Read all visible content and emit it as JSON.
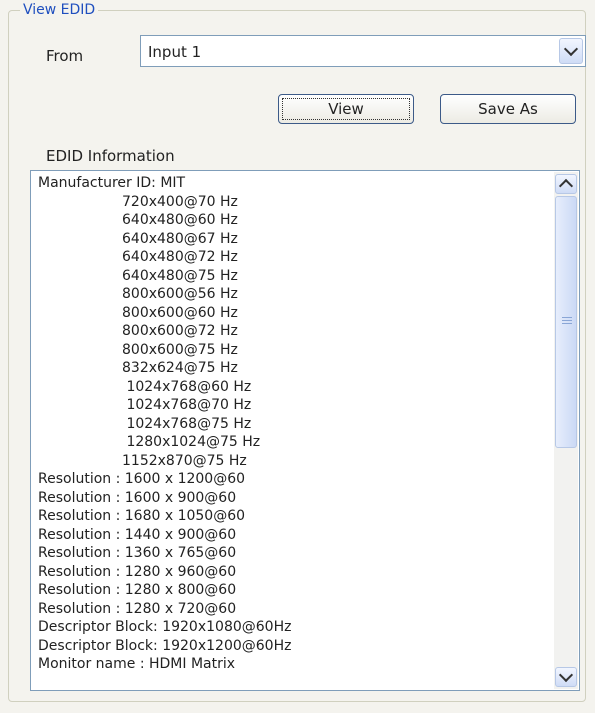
{
  "group": {
    "title": "View EDID"
  },
  "from": {
    "label": "From",
    "selected": "Input 1"
  },
  "buttons": {
    "view": "View",
    "save_as": "Save As"
  },
  "edid": {
    "label": "EDID Information",
    "lines": [
      {
        "text": "Manufacturer ID: MIT",
        "indent": false
      },
      {
        "text": "720x400@70 Hz",
        "indent": true
      },
      {
        "text": "640x480@60 Hz",
        "indent": true
      },
      {
        "text": "640x480@67 Hz",
        "indent": true
      },
      {
        "text": "640x480@72 Hz",
        "indent": true
      },
      {
        "text": "640x480@75 Hz",
        "indent": true
      },
      {
        "text": "800x600@56 Hz",
        "indent": true
      },
      {
        "text": "800x600@60 Hz",
        "indent": true
      },
      {
        "text": "800x600@72 Hz",
        "indent": true
      },
      {
        "text": "800x600@75 Hz",
        "indent": true
      },
      {
        "text": "832x624@75 Hz",
        "indent": true
      },
      {
        "text": " 1024x768@60 Hz",
        "indent": true
      },
      {
        "text": " 1024x768@70 Hz",
        "indent": true
      },
      {
        "text": " 1024x768@75 Hz",
        "indent": true
      },
      {
        "text": " 1280x1024@75 Hz",
        "indent": true
      },
      {
        "text": "1152x870@75 Hz",
        "indent": true
      },
      {
        "text": "Resolution : 1600 x 1200@60",
        "indent": false
      },
      {
        "text": "Resolution : 1600 x 900@60",
        "indent": false
      },
      {
        "text": "Resolution : 1680 x 1050@60",
        "indent": false
      },
      {
        "text": "Resolution : 1440 x 900@60",
        "indent": false
      },
      {
        "text": "Resolution : 1360 x 765@60",
        "indent": false
      },
      {
        "text": "Resolution : 1280 x 960@60",
        "indent": false
      },
      {
        "text": "Resolution : 1280 x 800@60",
        "indent": false
      },
      {
        "text": "Resolution : 1280 x 720@60",
        "indent": false
      },
      {
        "text": "Descriptor Block: 1920x1080@60Hz",
        "indent": false
      },
      {
        "text": "Descriptor Block: 1920x1200@60Hz",
        "indent": false
      },
      {
        "text": "Monitor name : HDMI Matrix",
        "indent": false
      }
    ]
  },
  "icons": {
    "combo_arrow": "chevron-down-icon",
    "scroll_up": "chevron-up-icon",
    "scroll_down": "chevron-down-icon",
    "scroll_grip": "grip-icon"
  },
  "colors": {
    "group_title": "#1f4fbf",
    "field_border": "#7f9db9",
    "window_bg": "#f4f3ee"
  }
}
